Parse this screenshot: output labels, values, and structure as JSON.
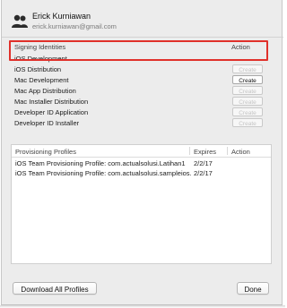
{
  "account": {
    "name": "Erick Kurniawan",
    "email": "erick.kurniawan@gmail.com",
    "avatar_icon": "two-person-icon"
  },
  "signing_identities": {
    "header": "Signing Identities",
    "action_header": "Action",
    "rows": [
      {
        "label": "iOS Development",
        "button": "",
        "enabled": false
      },
      {
        "label": "iOS Distribution",
        "button": "Create",
        "enabled": false
      },
      {
        "label": "Mac Development",
        "button": "Create",
        "enabled": true
      },
      {
        "label": "Mac App Distribution",
        "button": "Create",
        "enabled": false
      },
      {
        "label": "Mac Installer Distribution",
        "button": "Create",
        "enabled": false
      },
      {
        "label": "Developer ID Application",
        "button": "Create",
        "enabled": false
      },
      {
        "label": "Developer ID Installer",
        "button": "Create",
        "enabled": false
      }
    ]
  },
  "provisioning_profiles": {
    "header": "Provisioning Profiles",
    "expires_header": "Expires",
    "action_header": "Action",
    "rows": [
      {
        "name": "iOS Team Provisioning Profile: com.actualsolusi.Latihan1",
        "expires": "2/2/17"
      },
      {
        "name": "iOS Team Provisioning Profile: com.actualsolusi.sampleios...",
        "expires": "2/2/17"
      }
    ]
  },
  "footer": {
    "download_all": "Download All Profiles",
    "done": "Done"
  },
  "colors": {
    "highlight": "#e0302a",
    "panel": "#ececec"
  }
}
